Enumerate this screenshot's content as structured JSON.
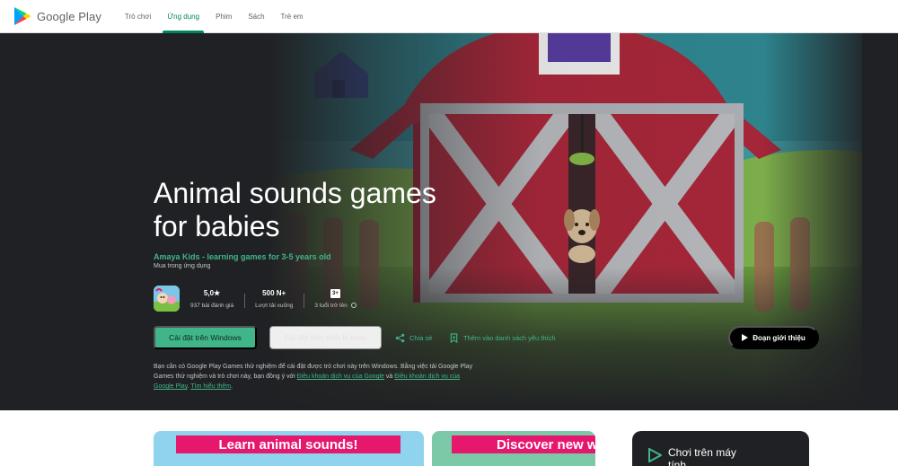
{
  "brand": {
    "name": "Google Play"
  },
  "nav": [
    {
      "label": "Trò chơi",
      "active": false
    },
    {
      "label": "Ứng dụng",
      "active": true
    },
    {
      "label": "Phim",
      "active": false
    },
    {
      "label": "Sách",
      "active": false
    },
    {
      "label": "Trẻ em",
      "active": false
    }
  ],
  "app": {
    "title": "Animal sounds games for babies",
    "developer": "Amaya Kids - learning games for 3-5 years old",
    "in_app_purchases": "Mua trong ứng dụng",
    "rating": "5,0★",
    "rating_count": "937 bài đánh giá",
    "downloads": "500 N+",
    "downloads_label": "Lượt tải xuống",
    "age_badge": "3+",
    "age_label": "3 tuổi trở lên"
  },
  "actions": {
    "install_windows": "Cài đặt trên Windows",
    "install_other": "Cài đặt trên thiết bị khác",
    "share": "Chia sẻ",
    "wishlist": "Thêm vào danh sách yêu thích",
    "trailer": "Đoạn giới thiệu"
  },
  "disclaimer": {
    "text1": "Bạn cần có Google Play Games thử nghiệm để cài đặt được trò chơi này trên Windows. Bằng việc tải Google Play Games thử nghiệm và trò chơi này, bạn đồng ý với ",
    "link_terms": "Điều khoản dịch vụ của Google",
    "and": " và ",
    "link_play_terms": "Điều khoản dịch vụ của Google Play",
    "comma": ". ",
    "link_more": "Tìm hiểu thêm",
    "end": "."
  },
  "screenshots": [
    {
      "banner": "Learn animal sounds!"
    },
    {
      "banner": "Discover new w"
    }
  ],
  "play_on_pc": {
    "label": "Chơi trên máy tính"
  },
  "colors": {
    "accent": "#01875f",
    "accent_dark": "#41b58a",
    "hero_bg": "#202124",
    "banner": "#e6186e",
    "barn_red": "#b3263a"
  },
  "icons": [
    "google-play-logo",
    "share-icon",
    "bookmark-icon",
    "play-icon",
    "info-icon"
  ]
}
